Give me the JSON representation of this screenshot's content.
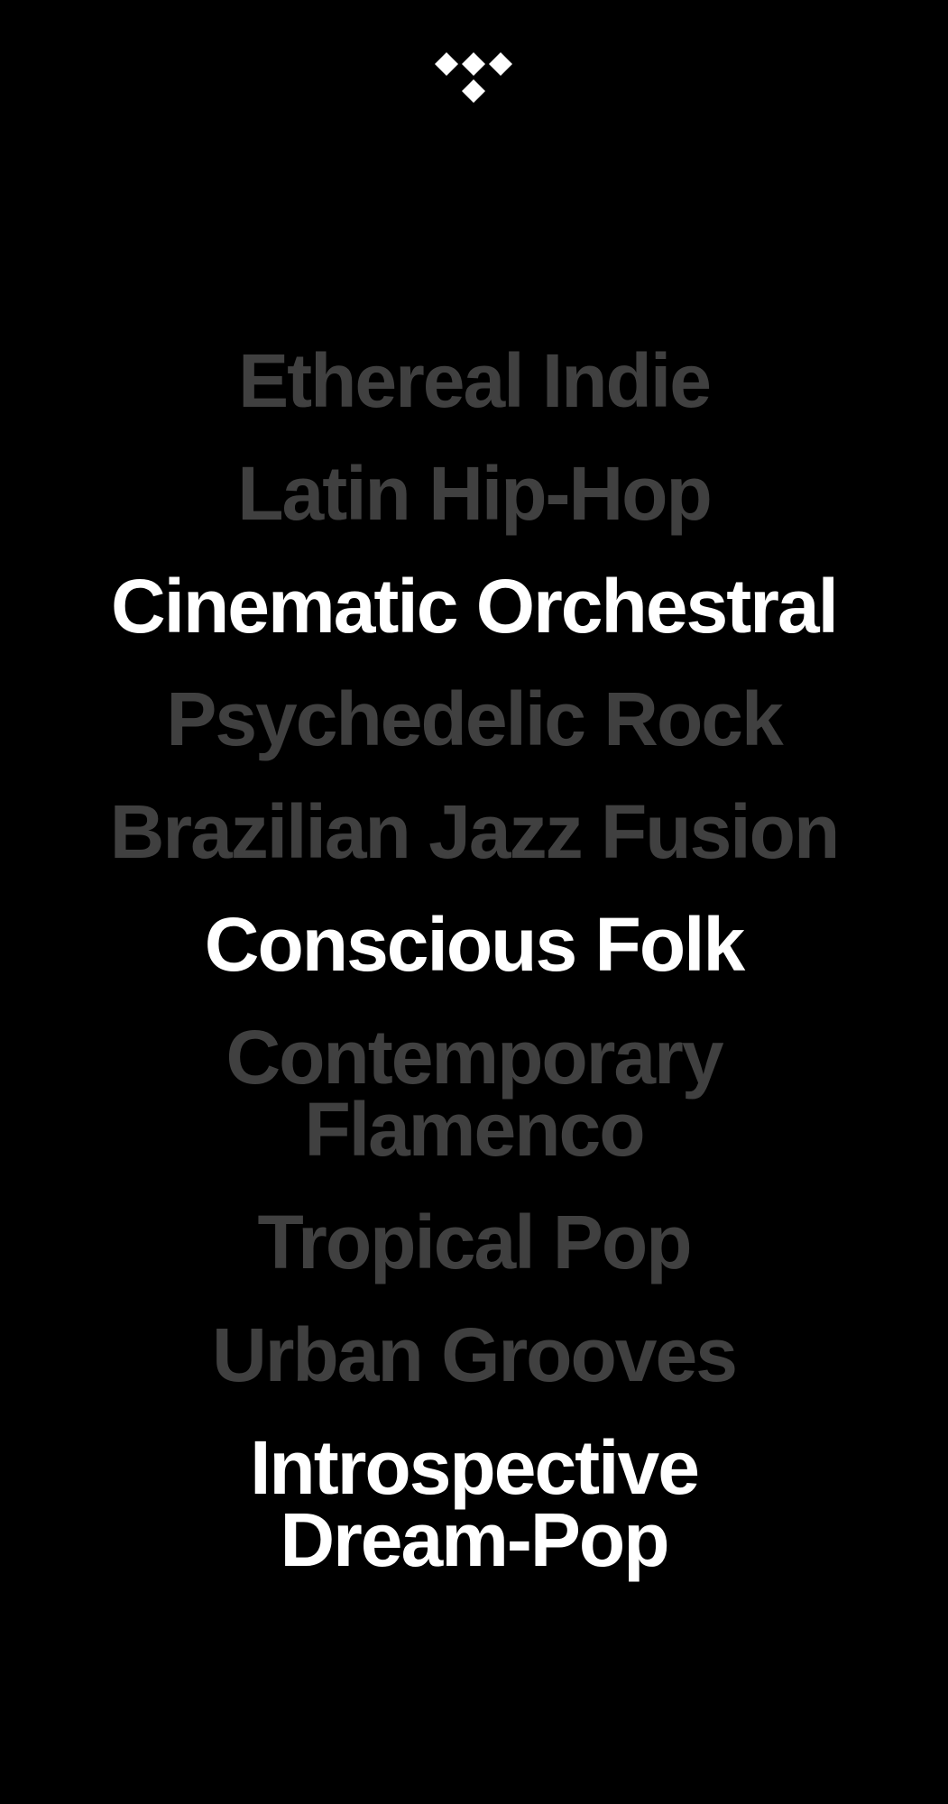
{
  "brand": {
    "logo_icon": "tidal-logo-icon"
  },
  "colors": {
    "background": "#000000",
    "active_text": "#ffffff",
    "inactive_text": "#404040"
  },
  "genres": [
    {
      "label": "Ethereal Indie",
      "state": "inactive"
    },
    {
      "label": "Latin Hip-Hop",
      "state": "inactive"
    },
    {
      "label": "Cinematic Orchestral",
      "state": "active"
    },
    {
      "label": "Psychedelic Rock",
      "state": "inactive"
    },
    {
      "label": "Brazilian Jazz Fusion",
      "state": "inactive"
    },
    {
      "label": "Conscious Folk",
      "state": "active"
    },
    {
      "label": "Contemporary Flamenco",
      "state": "inactive"
    },
    {
      "label": "Tropical Pop",
      "state": "inactive"
    },
    {
      "label": "Urban Grooves",
      "state": "inactive"
    },
    {
      "label": "Introspective Dream-Pop",
      "state": "active"
    }
  ]
}
